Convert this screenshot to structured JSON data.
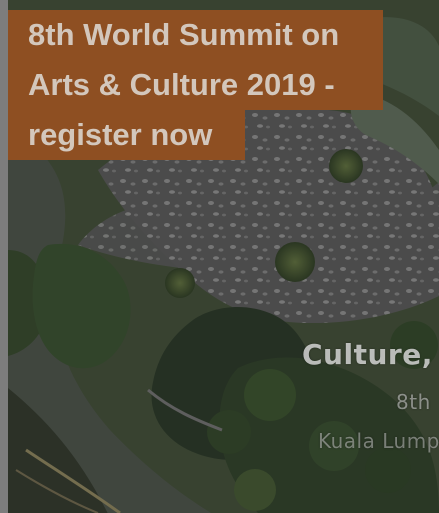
{
  "banner": {
    "headline_lines": [
      "8th World Summit on",
      "Arts & Culture 2019 -",
      "register now"
    ],
    "link_color": "#8e4f22",
    "text_color": "#d3c7bc"
  },
  "hero_overlay": {
    "line1": "Culture,",
    "line2": "8th",
    "line3": "Kuala Lump"
  }
}
